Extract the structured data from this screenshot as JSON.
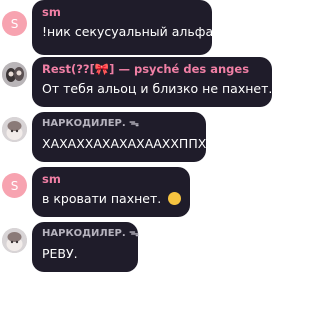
{
  "messages": [
    {
      "avatar": "S",
      "name": "sm",
      "text": "!ник секусуальный альфа"
    },
    {
      "avatar": "",
      "name": "Rest(??[🎀]",
      "name_sep": "—",
      "name_rest": "psyché des anges",
      "text": "От тебя альоц и близко не пахнет.."
    },
    {
      "avatar": "",
      "name": "НАРКОДИЛЕР.",
      "badge": "ᯓ",
      "text": "ХАХАХХАХАХАХААХХППХ"
    },
    {
      "avatar": "S",
      "name": "sm",
      "text": "в кровати пахнет.",
      "emoji": "smirk-emoji"
    },
    {
      "avatar": "",
      "name": "НАРКОДИЛЕР.",
      "badge": "ᯓ",
      "text": "РЕВУ."
    }
  ],
  "colors": {
    "bubble": "#1f1c2a",
    "name_pink": "#f07fa5",
    "name_gray": "#b6b3be",
    "avatar_s": "#f7a3b0",
    "text": "#ffffff"
  }
}
